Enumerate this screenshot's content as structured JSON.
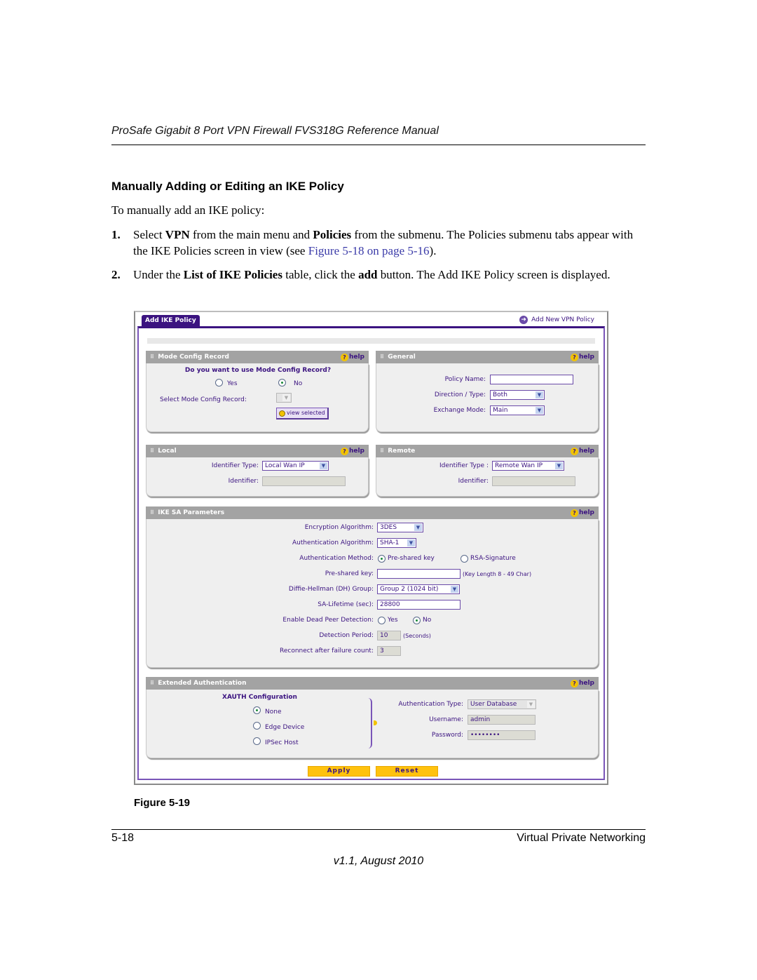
{
  "header": {
    "running_title": "ProSafe Gigabit 8 Port VPN Firewall FVS318G Reference Manual"
  },
  "section": {
    "heading": "Manually Adding or Editing an IKE Policy",
    "intro": "To manually add an IKE policy:",
    "steps": [
      {
        "num": "1.",
        "parts": [
          "Select ",
          "VPN",
          " from the main menu and ",
          "Policies",
          " from the submenu. The Policies submenu tabs appear with the IKE Policies screen in view (see ",
          "Figure 5-18 on page 5-16",
          ")."
        ]
      },
      {
        "num": "2.",
        "parts": [
          "Under the ",
          "List of IKE Policies",
          " table, click the ",
          "add",
          " button. The Add IKE Policy screen is displayed."
        ]
      }
    ]
  },
  "figure": {
    "tab_label": "Add IKE Policy",
    "add_new_vpn_label": "Add New VPN Policy",
    "help_label": "help",
    "mode_config": {
      "title": "Mode Config Record",
      "question": "Do you want to use Mode Config Record?",
      "yes_label": "Yes",
      "no_label": "No",
      "selected": "No",
      "select_label": "Select Mode Config Record:",
      "select_value": "",
      "view_selected_label": "view selected"
    },
    "general": {
      "title": "General",
      "policy_name_label": "Policy Name:",
      "policy_name_value": "",
      "direction_label": "Direction / Type:",
      "direction_value": "Both",
      "exchange_label": "Exchange Mode:",
      "exchange_value": "Main"
    },
    "local": {
      "title": "Local",
      "id_type_label": "Identifier Type:",
      "id_type_value": "Local Wan IP",
      "identifier_label": "Identifier:",
      "identifier_value": ""
    },
    "remote": {
      "title": "Remote",
      "id_type_label": "Identifier Type :",
      "id_type_value": "Remote Wan IP",
      "identifier_label": "Identifier:",
      "identifier_value": ""
    },
    "ike_sa": {
      "title": "IKE SA Parameters",
      "enc_label": "Encryption Algorithm:",
      "enc_value": "3DES",
      "auth_alg_label": "Authentication Algorithm:",
      "auth_alg_value": "SHA-1",
      "auth_method_label": "Authentication Method:",
      "psk_option": "Pre-shared key",
      "rsa_option": "RSA-Signature",
      "auth_method_selected": "Pre-shared key",
      "psk_label": "Pre-shared key:",
      "psk_value": "",
      "psk_hint": "(Key Length 8 - 49 Char)",
      "dh_label": "Diffie-Hellman (DH) Group:",
      "dh_value": "Group 2 (1024 bit)",
      "lifetime_label": "SA-Lifetime (sec):",
      "lifetime_value": "28800",
      "dpd_label": "Enable Dead Peer Detection:",
      "dpd_yes": "Yes",
      "dpd_no": "No",
      "dpd_selected": "No",
      "period_label": "Detection Period:",
      "period_value": "10",
      "period_unit": "(Seconds)",
      "reconnect_label": "Reconnect after failure count:",
      "reconnect_value": "3"
    },
    "xauth": {
      "title": "Extended Authentication",
      "config_heading": "XAUTH Configuration",
      "options": [
        "None",
        "Edge Device",
        "IPSec Host"
      ],
      "selected": "None",
      "auth_type_label": "Authentication Type:",
      "auth_type_value": "User Database",
      "username_label": "Username:",
      "username_value": "admin",
      "password_label": "Password:",
      "password_value": "••••••••"
    },
    "apply_label": "Apply",
    "reset_label": "Reset",
    "colors": {
      "accent": "#3b1380",
      "panel_header": "#a3a3a3",
      "button": "#ffc20e"
    }
  },
  "caption": "Figure 5-19",
  "footer": {
    "page": "5-18",
    "chapter": "Virtual Private Networking",
    "version": "v1.1, August 2010"
  }
}
